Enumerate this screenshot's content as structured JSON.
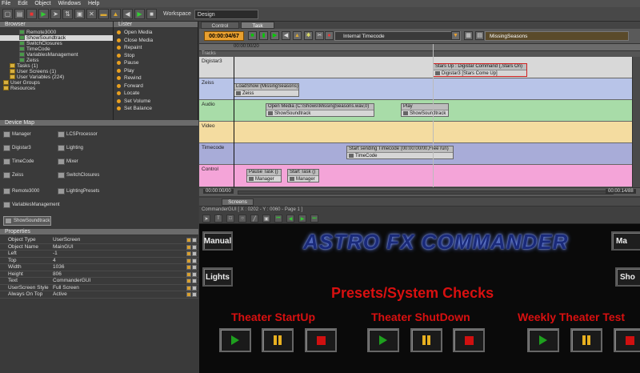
{
  "menu": [
    "File",
    "Edit",
    "Object",
    "Windows",
    "Help"
  ],
  "workspace": {
    "label": "Workspace",
    "value": "Design"
  },
  "browser": {
    "title": "Browser",
    "items": [
      {
        "label": "Remote3000",
        "icon": "device"
      },
      {
        "label": "ShowSoundtrack",
        "icon": "device",
        "selected": true
      },
      {
        "label": "SwitchClosures",
        "icon": "device"
      },
      {
        "label": "TimeCode",
        "icon": "device"
      },
      {
        "label": "VariablesManagement",
        "icon": "device"
      },
      {
        "label": "Zeiss",
        "icon": "device"
      },
      {
        "label": "Tasks (1)",
        "icon": "folder"
      },
      {
        "label": "User Screens (1)",
        "icon": "folder"
      },
      {
        "label": "User Variables (224)",
        "icon": "folder"
      },
      {
        "label": "User Groups",
        "icon": "folder"
      },
      {
        "label": "Resources",
        "icon": "folder"
      }
    ]
  },
  "lister": {
    "title": "Lister",
    "items": [
      "Open Media",
      "Close Media",
      "Repaint",
      "Stop",
      "Pause",
      "Play",
      "Rewind",
      "Forward",
      "Locate",
      "Set Volume",
      "Set Balance"
    ]
  },
  "devicemap": {
    "title": "Device Map",
    "devices": [
      "Manager",
      "LCSProcessor",
      "Digistar3",
      "Lighting",
      "TimeCode",
      "Mixer",
      "Zeiss",
      "SwitchClosures",
      "Remote3000",
      "LightingPresets",
      "VariablesManagement",
      "ShowSoundtrack"
    ]
  },
  "properties": {
    "title": "Properties",
    "rows": [
      {
        "k": "Object Type",
        "v": "UserScreen"
      },
      {
        "k": "Object Name",
        "v": "MainGUI"
      },
      {
        "k": "Left",
        "v": "-1"
      },
      {
        "k": "Top",
        "v": "4"
      },
      {
        "k": "Width",
        "v": "1036"
      },
      {
        "k": "Height",
        "v": "806"
      },
      {
        "k": "Text",
        "v": "CommanderGUI"
      },
      {
        "k": "UserScreen Style",
        "v": "Full Screen"
      },
      {
        "k": "Always On Top",
        "v": "Active"
      }
    ]
  },
  "tabs": [
    "Control",
    "Task"
  ],
  "sequencer": {
    "timecode": "00:00:04/67",
    "source": "Internal Timecode",
    "sequence_name": "MissingSeasons",
    "ruler_start": "00:00:00/20",
    "tracks_label": "Tracks",
    "start_time": "00:00:00/00",
    "end_time": "00:00:14/88"
  },
  "tracks": [
    {
      "name": "Digistar3",
      "color": "#d8d8d8",
      "clips": [
        {
          "title": "Stars Up : Digistar Command (,Stars On)",
          "body": "Digistar3 [Stars Come Up]"
        }
      ]
    },
    {
      "name": "Zeiss",
      "color": "#b8c4e8",
      "clips": [
        {
          "title": "LoadShow (MissingSeasons)",
          "body": "Zeiss"
        }
      ]
    },
    {
      "name": "Audio",
      "color": "#a8dca8",
      "clips": [
        {
          "title": "Open Media (C:\\Shows\\MissingSeasons.wav,0)",
          "body": "ShowSoundtrack"
        },
        {
          "title": "Play",
          "body": "ShowSoundtrack"
        }
      ]
    },
    {
      "name": "Video",
      "color": "#f4dca0",
      "clips": []
    },
    {
      "name": "Timecode",
      "color": "#a8acd8",
      "clips": [
        {
          "title": "Start sending Timecode (00:00:00/00,Free run)",
          "body": "TimeCode"
        }
      ]
    },
    {
      "name": "Control",
      "color": "#f4a4d8",
      "clips": [
        {
          "title": "Pause Task ()",
          "body": "Manager"
        },
        {
          "title": "Start Task ()",
          "body": "Manager"
        }
      ]
    }
  ],
  "screens": {
    "title": "Screens",
    "path": "CommanderGUI [ X : 0202 - Y : 0060 - Page 1 ]"
  },
  "gui": {
    "logo": "ASTRO FX COMMANDER",
    "buttons": {
      "manual": "Manual",
      "lights": "Lights",
      "manual_right": "Ma",
      "show_right": "Sho"
    },
    "heading": "Presets/System Checks",
    "groups": [
      "Theater StartUp",
      "Theater ShutDown",
      "Weekly Theater Test"
    ]
  }
}
